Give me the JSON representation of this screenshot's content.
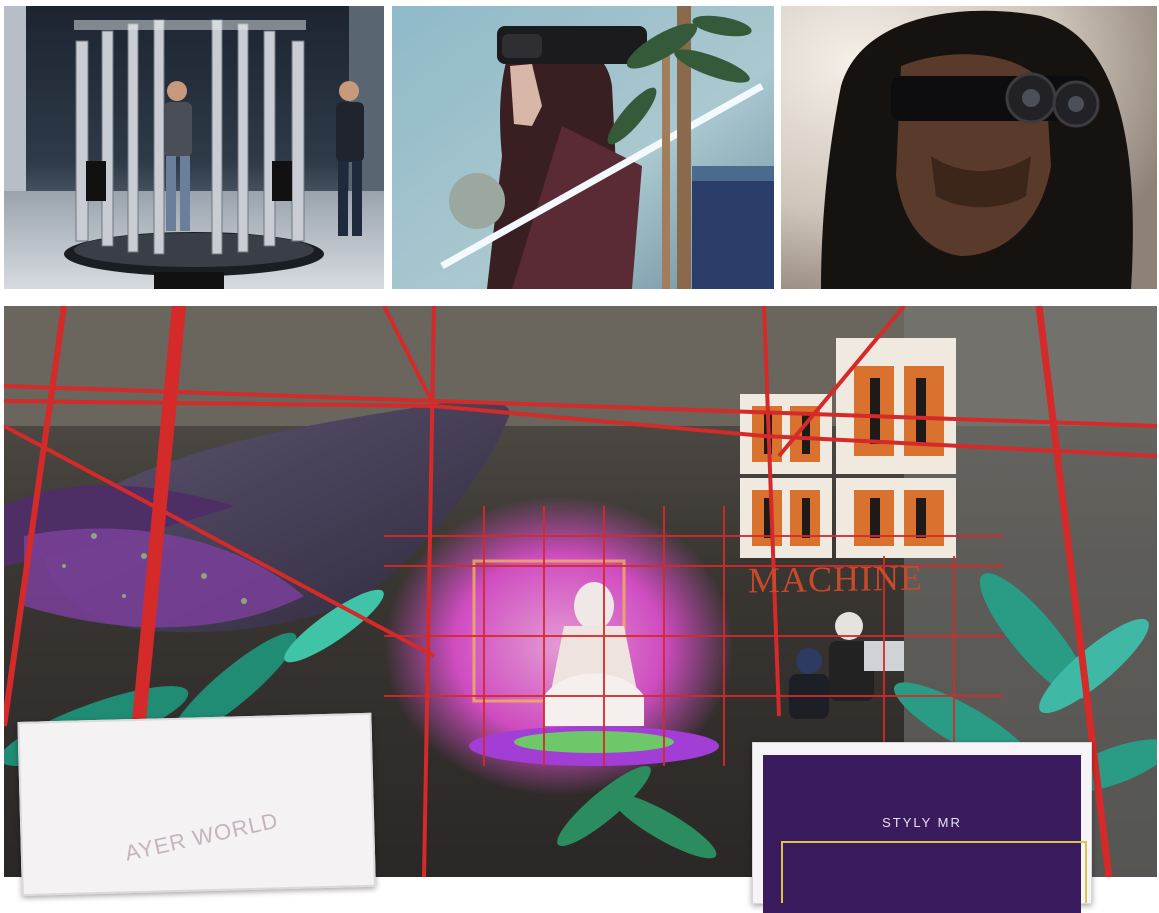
{
  "tiles": [
    {
      "id": "scan-rig",
      "subject": "volumetric capture rig with two men"
    },
    {
      "id": "headset-woman",
      "subject": "woman wearing mixed reality headset with plants"
    },
    {
      "id": "headset-man",
      "subject": "man in hood wearing mixed reality goggles"
    },
    {
      "id": "mr-scene",
      "subject": "mixed reality exhibition with whale, grid and plants"
    }
  ],
  "scene": {
    "sign_text": "MACHINE",
    "left_panel_text": "AYER WORLD",
    "right_panel_text": "STYLY MR"
  },
  "colors": {
    "grid_red": "#d42a2a",
    "sign_orange": "#c94a2a",
    "panel_purple": "#3a1c5e",
    "glow_pink": "#e04fd0"
  }
}
